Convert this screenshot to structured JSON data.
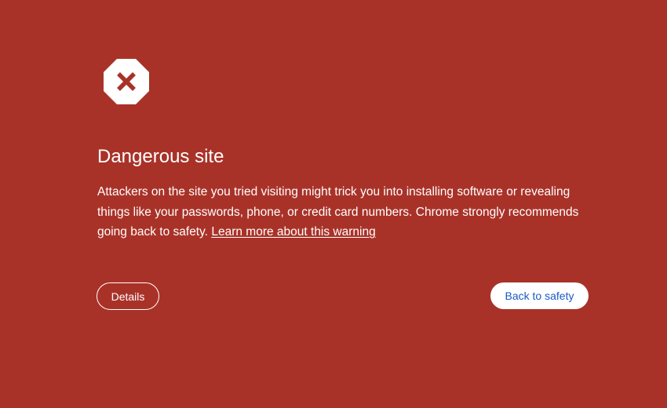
{
  "warning": {
    "icon": "stop-sign-x-icon",
    "title": "Dangerous site",
    "body_text": "Attackers on the site you tried visiting might trick you into installing software or revealing things like your passwords, phone, or credit card numbers. Chrome strongly recommends going back to safety.",
    "learn_more_link": "Learn more about this warning"
  },
  "buttons": {
    "details_label": "Details",
    "back_to_safety_label": "Back to safety"
  },
  "colors": {
    "background": "#A93228",
    "text": "#FFFFFF",
    "primary_button_text": "#1A59C8"
  }
}
